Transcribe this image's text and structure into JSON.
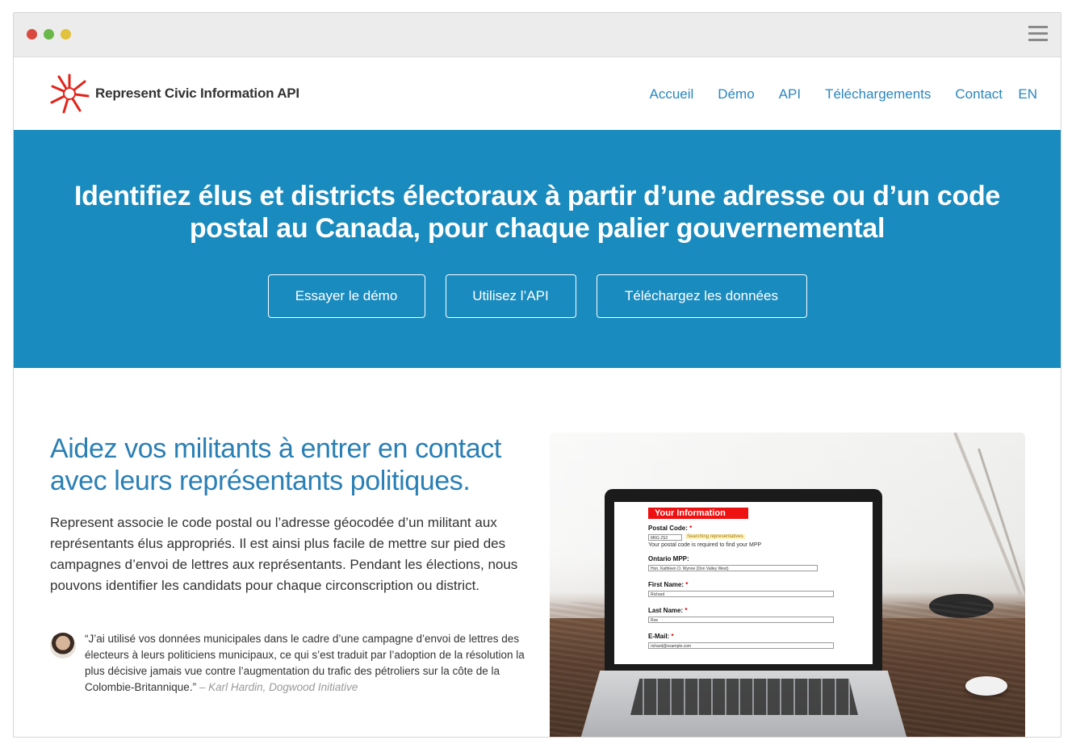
{
  "window": {
    "colors": {
      "red": "#d9493f",
      "green": "#6bb84a",
      "yellow": "#e2c13c"
    }
  },
  "navbar": {
    "brand": "Represent Civic Information API",
    "logo_icon": "starburst-logo-icon",
    "links": [
      "Accueil",
      "Démo",
      "API",
      "Téléchargements",
      "Contact"
    ],
    "lang": "EN"
  },
  "hero": {
    "title": "Identifiez élus et districts électoraux à partir d’une adresse ou d’un code postal au Canada, pour chaque palier gouvernemental",
    "buttons": [
      "Essayer le démo",
      "Utilisez l’API",
      "Téléchargez les données"
    ],
    "bg_color": "#1a8bbf"
  },
  "content": {
    "lead": "Aidez vos militants à entrer en contact avec leurs représentants politiques.",
    "body": "Represent associe le code postal ou l’adresse géocodée d’un militant aux représentants élus appropriés. Il est ainsi plus facile de mettre sur pied des campagnes d’envoi de lettres aux représentants. Pendant les élections, nous pouvons identifier les candidats pour chaque circonscription ou district.",
    "quote": "“J’ai utilisé vos données municipales dans le cadre d’une campagne d’envoi de lettres des électeurs à leurs politiciens municipaux, ce qui s’est traduit par l’adoption de la résolution la plus décisive jamais vue contre l’augmentation du trafic des pétroliers sur la côte de la Colombie-Britannique.”",
    "quote_cite": "– Karl Hardin, Dogwood Initiative"
  },
  "laptop_form": {
    "title": "Your Information",
    "postal_label": "Postal Code:",
    "postal_value": "M6G 2S2",
    "searching": "Searching representatives",
    "postal_hint": "Your postal code is required to find your MPP",
    "mpp_label": "Ontario MPP:",
    "mpp_value": "Hon. Kathleen O. Wynne (Don Valley West)",
    "first_label": "First Name:",
    "first_value": "Richard",
    "last_label": "Last Name:",
    "last_value": "Roe",
    "email_label": "E-Mail:",
    "email_value": "richard@example.com",
    "required_mark": "*"
  }
}
